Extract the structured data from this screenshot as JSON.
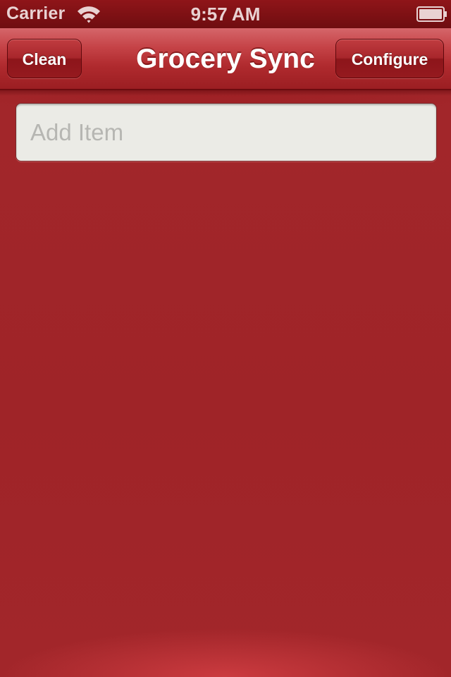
{
  "status_bar": {
    "carrier": "Carrier",
    "time": "9:57 AM",
    "icons": [
      "wifi-icon",
      "battery-icon"
    ]
  },
  "nav": {
    "title": "Grocery Sync",
    "left_button": "Clean",
    "right_button": "Configure"
  },
  "add_item": {
    "value": "",
    "placeholder": "Add Item"
  },
  "colors": {
    "background": "#a1262a",
    "nav_bar": "#b02a2e",
    "status_bar": "#7a1014",
    "field": "#ebebe6"
  }
}
